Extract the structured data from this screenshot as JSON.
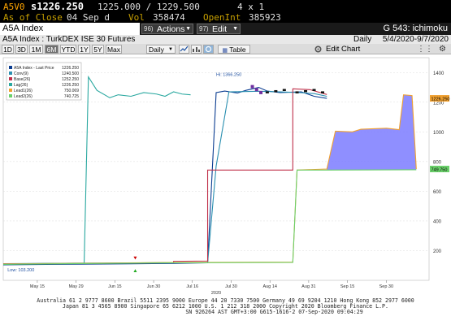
{
  "quote": {
    "ticker": "A5V0",
    "last": "s1226.250",
    "bid_ask": "1225.000 / 1229.500",
    "size": "4 x 1",
    "close_label": "As of Close",
    "close_date": "04 Sep d",
    "vol_label": "Vol",
    "vol": "358474",
    "oi_label": "OpenInt",
    "oi": "385923"
  },
  "title_bar": {
    "security": "A5A Index",
    "actions_num": "96)",
    "actions_label": "Actions",
    "edit_num": "97)",
    "edit_label": "Edit",
    "page_label": "G 543: ichimoku"
  },
  "sub_bar": {
    "description": "A5A Index : TurkDEX ISE 30 Futures",
    "frequency": "Daily",
    "date_range": "5/4/2020-9/7/2020"
  },
  "toolbar": {
    "periods": [
      "1D",
      "3D",
      "1M",
      "6M",
      "YTD",
      "1Y",
      "5Y",
      "Max"
    ],
    "active_period": "6M",
    "interval": "Daily",
    "table_label": "Table",
    "edit_chart_label": "Edit Chart"
  },
  "chart_data": {
    "type": "line",
    "x_ticks": [
      "May 15",
      "May 29",
      "Jun 15",
      "Jun 30",
      "Jul 16",
      "Jul 30",
      "Aug 14",
      "Aug 31",
      "Sep 15",
      "Sep 30"
    ],
    "x_year_label": "2020",
    "ylim": [
      0,
      1500
    ],
    "y_ticks": [
      200,
      400,
      600,
      800,
      1000,
      1200,
      1400
    ],
    "legend": [
      {
        "name": "A5A Index - Last Price",
        "value": "1226.250",
        "color": "#0b3d91"
      },
      {
        "name": "Conv(9)",
        "value": "1240.500",
        "color": "#2a8fb0"
      },
      {
        "name": "Base(26)",
        "value": "1252.250",
        "color": "#c0304a"
      },
      {
        "name": "Lag(26)",
        "value": "1226.250",
        "color": "#2aa8a0"
      },
      {
        "name": "Lead1(26)",
        "value": "750.069",
        "color": "#f0a030"
      },
      {
        "name": "Lead2(26)",
        "value": "740.725",
        "color": "#6ad06a"
      }
    ],
    "series": [
      {
        "name": "A5A Index - Last Price",
        "color": "#0b3d91",
        "points": [
          [
            0,
            104
          ],
          [
            0.1,
            107
          ],
          [
            0.2,
            109
          ],
          [
            0.3,
            111
          ],
          [
            0.4,
            114
          ],
          [
            0.48,
            118
          ],
          [
            0.5,
            1265
          ],
          [
            0.52,
            1275
          ],
          [
            0.55,
            1262
          ],
          [
            0.57,
            1280
          ],
          [
            0.6,
            1300
          ],
          [
            0.62,
            1275
          ],
          [
            0.65,
            1265
          ],
          [
            0.7,
            1270
          ],
          [
            0.73,
            1240
          ],
          [
            0.76,
            1226
          ]
        ]
      },
      {
        "name": "Conv(9)",
        "color": "#2a8fb0",
        "points": [
          [
            0,
            112
          ],
          [
            0.1,
            114
          ],
          [
            0.2,
            116
          ],
          [
            0.3,
            117
          ],
          [
            0.4,
            120
          ],
          [
            0.48,
            118
          ],
          [
            0.5,
            770
          ],
          [
            0.53,
            1270
          ],
          [
            0.6,
            1274
          ],
          [
            0.65,
            1270
          ],
          [
            0.7,
            1264
          ],
          [
            0.73,
            1258
          ],
          [
            0.76,
            1240
          ]
        ]
      },
      {
        "name": "Base(26)",
        "color": "#c0304a",
        "points": [
          [
            0,
            111
          ],
          [
            0.2,
            114
          ],
          [
            0.38,
            118
          ],
          [
            0.4,
            118
          ],
          [
            0.4,
            128
          ],
          [
            0.48,
            130
          ],
          [
            0.48,
            743
          ],
          [
            0.68,
            743
          ],
          [
            0.68,
            1290
          ],
          [
            0.72,
            1285
          ],
          [
            0.76,
            1252
          ]
        ]
      },
      {
        "name": "Lag(26)",
        "color": "#2aa8a0",
        "points": [
          [
            0,
            108
          ],
          [
            0.1,
            113
          ],
          [
            0.19,
            116
          ],
          [
            0.2,
            1370
          ],
          [
            0.22,
            1280
          ],
          [
            0.25,
            1230
          ],
          [
            0.27,
            1250
          ],
          [
            0.3,
            1240
          ],
          [
            0.33,
            1265
          ],
          [
            0.36,
            1255
          ],
          [
            0.38,
            1240
          ],
          [
            0.4,
            1270
          ],
          [
            0.42,
            1255
          ],
          [
            0.44,
            1250
          ]
        ]
      },
      {
        "name": "Lead1(26)",
        "color": "#f0a030",
        "points": [
          [
            0,
            110
          ],
          [
            0.4,
            120
          ],
          [
            0.68,
            123
          ],
          [
            0.69,
            743
          ],
          [
            0.76,
            750
          ],
          [
            0.78,
            1005
          ],
          [
            0.82,
            1000
          ],
          [
            0.84,
            1018
          ],
          [
            0.9,
            1025
          ],
          [
            0.93,
            1015
          ],
          [
            0.94,
            1250
          ],
          [
            0.96,
            1245
          ],
          [
            0.97,
            750
          ]
        ]
      },
      {
        "name": "Lead2(26)",
        "color": "#6ad06a",
        "points": [
          [
            0,
            108
          ],
          [
            0.4,
            118
          ],
          [
            0.68,
            121
          ],
          [
            0.69,
            743
          ],
          [
            0.76,
            743
          ],
          [
            0.97,
            745
          ]
        ]
      }
    ],
    "annotations": {
      "high": "Hi: 1366.250",
      "low": "Low: 103.200",
      "last_price_tag": "1226.250",
      "lead_tag": "749.750"
    }
  },
  "footer": {
    "line1": "Australia 61 2 9777 8600  Brazil 5511 2395 9000  Europe 44 20 7330 7500  Germany 49 69 9204 1210  Hong Kong 852 2977 6000",
    "line2": "Japan 81 3 4565 8900          Singapore 65 6212 1000    U.S. 1 212 318 2000          Copyright 2020 Bloomberg Finance L.P.",
    "line3": "SN 926264 AST  GMT+3:00 G615-1616-2 07-Sep-2020 09:04:29"
  }
}
